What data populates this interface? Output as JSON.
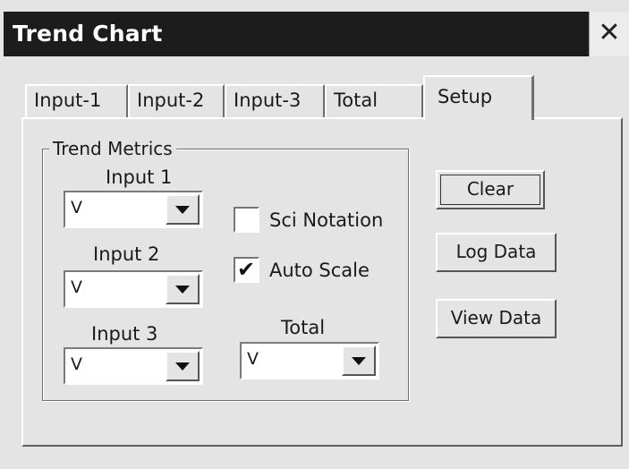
{
  "window": {
    "title": "Trend Chart",
    "close_glyph": "✕"
  },
  "tabs": [
    {
      "label": "Input-1",
      "active": false
    },
    {
      "label": "Input-2",
      "active": false
    },
    {
      "label": "Input-3",
      "active": false
    },
    {
      "label": "Total",
      "active": false
    },
    {
      "label": "Setup",
      "active": true
    }
  ],
  "trend_metrics": {
    "legend": "Trend Metrics",
    "input1": {
      "label": "Input 1",
      "value": "V"
    },
    "input2": {
      "label": "Input 2",
      "value": "V"
    },
    "input3": {
      "label": "Input 3",
      "value": "V"
    },
    "total": {
      "label": "Total",
      "value": "V"
    },
    "sci_notation": {
      "label": "Sci Notation",
      "checked": false
    },
    "auto_scale": {
      "label": "Auto Scale",
      "checked": true,
      "mark": "✔"
    }
  },
  "buttons": {
    "clear": "Clear",
    "log_data": "Log Data",
    "view_data": "View Data"
  }
}
